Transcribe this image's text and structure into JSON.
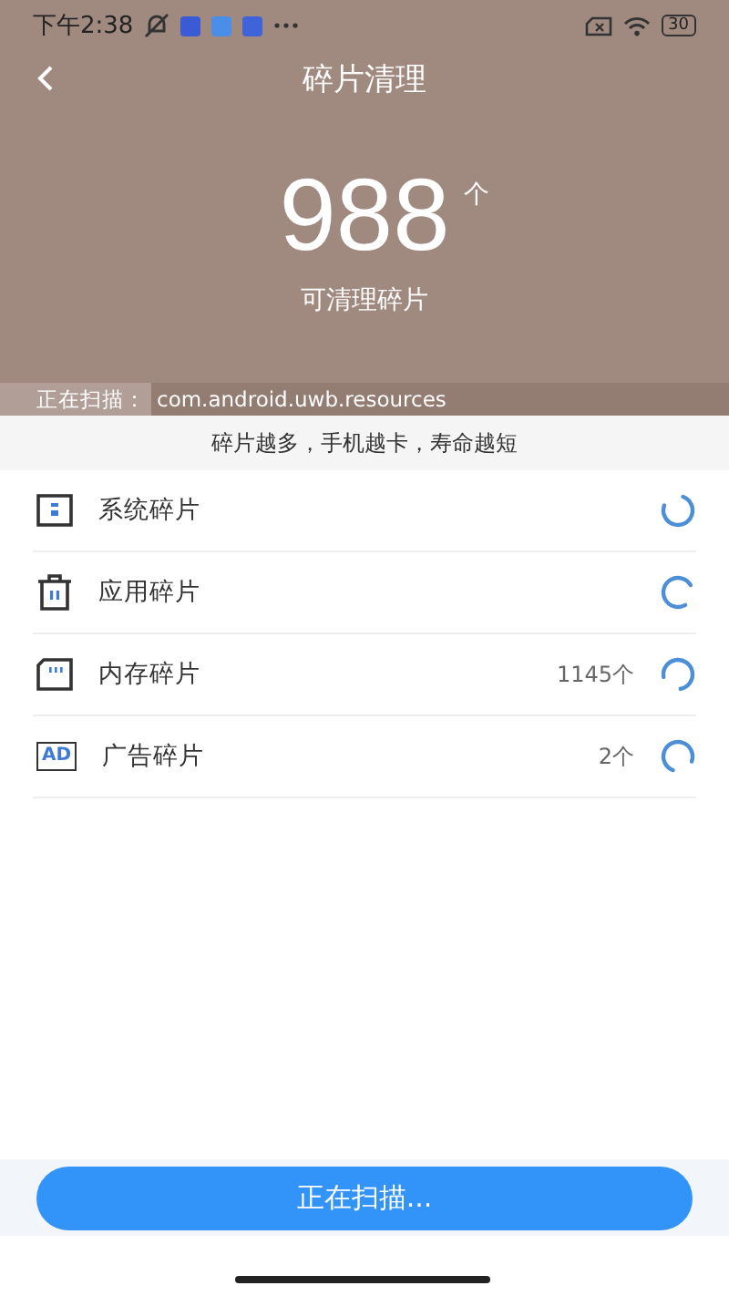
{
  "status_bar": {
    "time": "下午2:38",
    "battery": "30"
  },
  "header": {
    "title": "碎片清理",
    "count": "988",
    "unit": "个",
    "caption": "可清理碎片",
    "scan_label": "正在扫描：",
    "scan_path": "com.android.uwb.resources"
  },
  "notice": "碎片越多，手机越卡，寿命越短",
  "items": [
    {
      "kind": "system",
      "label": "系统碎片"
    },
    {
      "kind": "app",
      "label": "应用碎片"
    },
    {
      "kind": "memory",
      "label": "内存碎片",
      "count": "1145个"
    },
    {
      "kind": "ad",
      "label": "广告碎片",
      "count": "2个",
      "icon_text": "AD"
    }
  ],
  "button": "正在扫描..."
}
